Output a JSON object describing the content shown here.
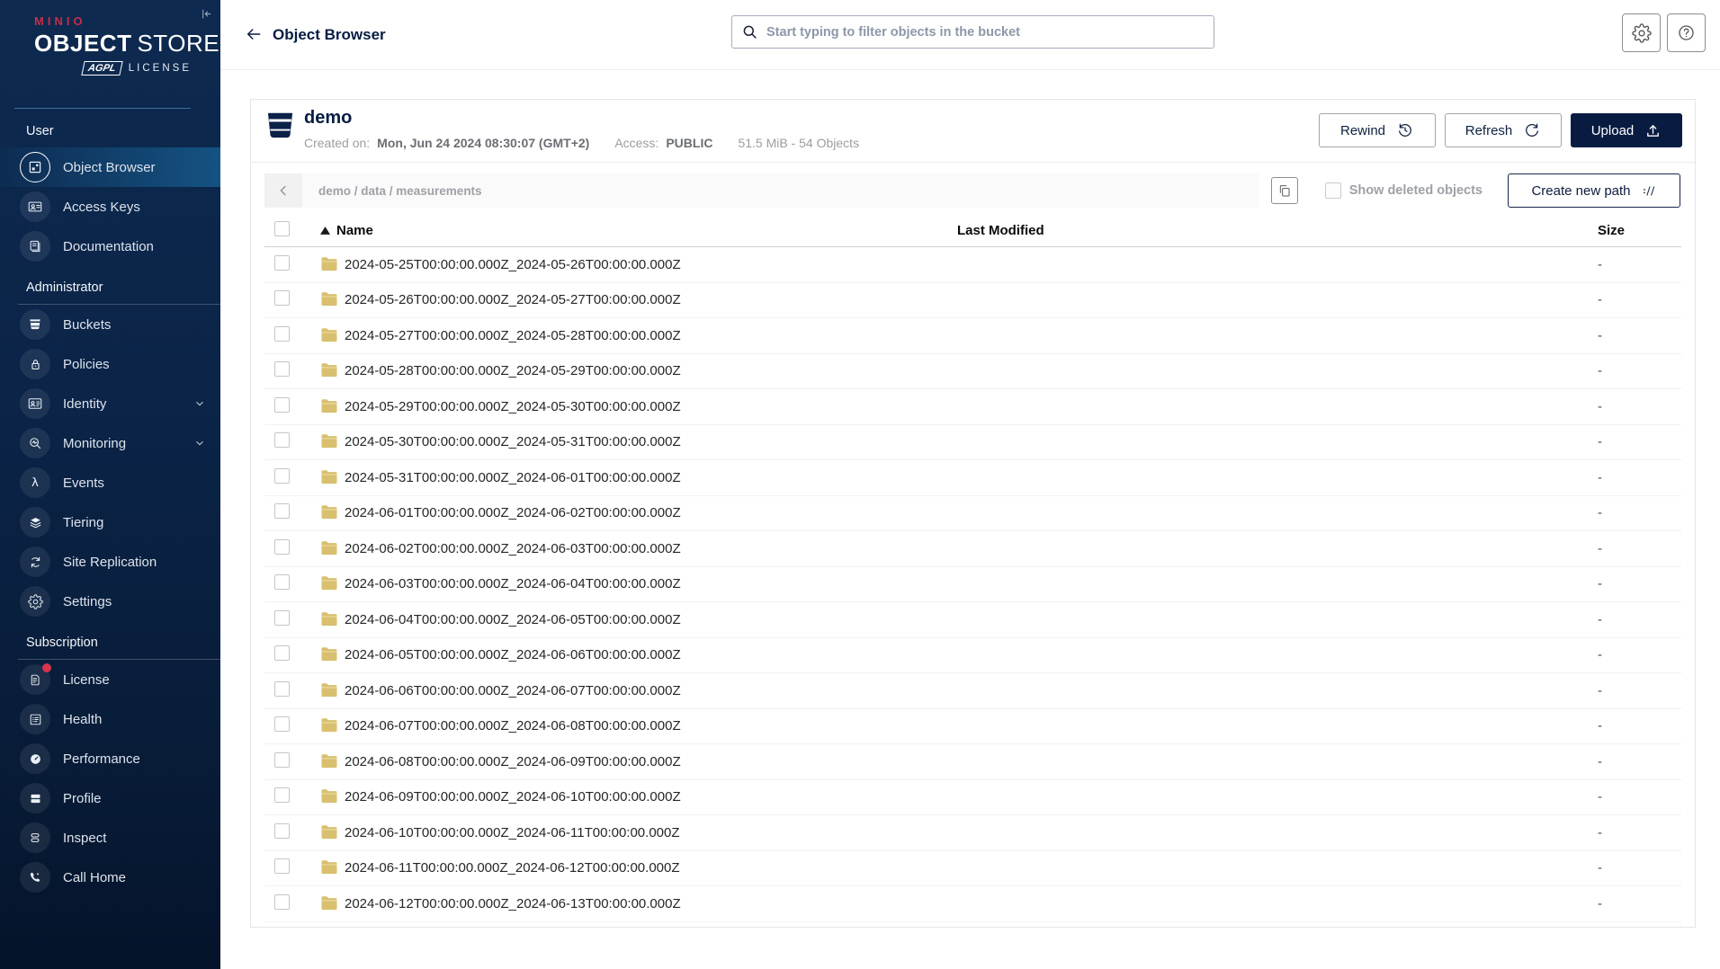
{
  "colors": {
    "brand_red": "#C72C48",
    "primary_navy": "#081C42",
    "sidebar_top": "#0E2A50",
    "sidebar_bottom": "#05132A",
    "selected_item_highlight": "#155585",
    "folder_icon": "#D8C06F",
    "badge_red": "#D8354F"
  },
  "sidebar": {
    "logo": {
      "brand": "MINIO",
      "product_bold": "OBJECT",
      "product_light": "STORE",
      "license_badge": "AGPL",
      "license_label": "LICENSE"
    },
    "sections": [
      {
        "label": "User",
        "items": [
          {
            "icon": "object-browser-icon",
            "label": "Object Browser",
            "selected": true
          },
          {
            "icon": "access-keys-icon",
            "label": "Access Keys"
          },
          {
            "icon": "documentation-icon",
            "label": "Documentation"
          }
        ]
      },
      {
        "label": "Administrator",
        "items": [
          {
            "icon": "buckets-icon",
            "label": "Buckets"
          },
          {
            "icon": "policies-icon",
            "label": "Policies"
          },
          {
            "icon": "identity-icon",
            "label": "Identity",
            "chevron": true
          },
          {
            "icon": "monitoring-icon",
            "label": "Monitoring",
            "chevron": true
          },
          {
            "icon": "events-icon",
            "label": "Events"
          },
          {
            "icon": "tiering-icon",
            "label": "Tiering"
          },
          {
            "icon": "site-replication-icon",
            "label": "Site Replication"
          },
          {
            "icon": "settings-icon",
            "label": "Settings"
          }
        ]
      },
      {
        "label": "Subscription",
        "items": [
          {
            "icon": "license-icon",
            "label": "License",
            "badge": true
          },
          {
            "icon": "health-icon",
            "label": "Health"
          },
          {
            "icon": "performance-icon",
            "label": "Performance"
          },
          {
            "icon": "profile-icon",
            "label": "Profile"
          },
          {
            "icon": "inspect-icon",
            "label": "Inspect"
          },
          {
            "icon": "call-home-icon",
            "label": "Call Home"
          }
        ]
      }
    ]
  },
  "header": {
    "title": "Object Browser",
    "search_placeholder": "Start typing to filter objects in the bucket"
  },
  "bucket": {
    "name": "demo",
    "created_label": "Created on:",
    "created_value": "Mon, Jun 24 2024 08:30:07 (GMT+2)",
    "access_label": "Access:",
    "access_value": "PUBLIC",
    "stats": "51.5 MiB - 54 Objects",
    "actions": {
      "rewind": "Rewind",
      "refresh": "Refresh",
      "upload": "Upload"
    }
  },
  "browser": {
    "breadcrumb": "demo / data / measurements",
    "show_deleted_label": "Show deleted objects",
    "create_path_label": "Create new path"
  },
  "table": {
    "columns": [
      "Name",
      "Last Modified",
      "Size"
    ],
    "sort": {
      "column": "Name",
      "direction": "asc"
    },
    "rows": [
      {
        "icon": "folder-icon",
        "name": "2024-05-25T00:00:00.000Z_2024-05-26T00:00:00.000Z",
        "last_modified": "",
        "size": "-"
      },
      {
        "icon": "folder-icon",
        "name": "2024-05-26T00:00:00.000Z_2024-05-27T00:00:00.000Z",
        "last_modified": "",
        "size": "-"
      },
      {
        "icon": "folder-icon",
        "name": "2024-05-27T00:00:00.000Z_2024-05-28T00:00:00.000Z",
        "last_modified": "",
        "size": "-"
      },
      {
        "icon": "folder-icon",
        "name": "2024-05-28T00:00:00.000Z_2024-05-29T00:00:00.000Z",
        "last_modified": "",
        "size": "-"
      },
      {
        "icon": "folder-icon",
        "name": "2024-05-29T00:00:00.000Z_2024-05-30T00:00:00.000Z",
        "last_modified": "",
        "size": "-"
      },
      {
        "icon": "folder-icon",
        "name": "2024-05-30T00:00:00.000Z_2024-05-31T00:00:00.000Z",
        "last_modified": "",
        "size": "-"
      },
      {
        "icon": "folder-icon",
        "name": "2024-05-31T00:00:00.000Z_2024-06-01T00:00:00.000Z",
        "last_modified": "",
        "size": "-"
      },
      {
        "icon": "folder-icon",
        "name": "2024-06-01T00:00:00.000Z_2024-06-02T00:00:00.000Z",
        "last_modified": "",
        "size": "-"
      },
      {
        "icon": "folder-icon",
        "name": "2024-06-02T00:00:00.000Z_2024-06-03T00:00:00.000Z",
        "last_modified": "",
        "size": "-"
      },
      {
        "icon": "folder-icon",
        "name": "2024-06-03T00:00:00.000Z_2024-06-04T00:00:00.000Z",
        "last_modified": "",
        "size": "-"
      },
      {
        "icon": "folder-icon",
        "name": "2024-06-04T00:00:00.000Z_2024-06-05T00:00:00.000Z",
        "last_modified": "",
        "size": "-"
      },
      {
        "icon": "folder-icon",
        "name": "2024-06-05T00:00:00.000Z_2024-06-06T00:00:00.000Z",
        "last_modified": "",
        "size": "-"
      },
      {
        "icon": "folder-icon",
        "name": "2024-06-06T00:00:00.000Z_2024-06-07T00:00:00.000Z",
        "last_modified": "",
        "size": "-"
      },
      {
        "icon": "folder-icon",
        "name": "2024-06-07T00:00:00.000Z_2024-06-08T00:00:00.000Z",
        "last_modified": "",
        "size": "-"
      },
      {
        "icon": "folder-icon",
        "name": "2024-06-08T00:00:00.000Z_2024-06-09T00:00:00.000Z",
        "last_modified": "",
        "size": "-"
      },
      {
        "icon": "folder-icon",
        "name": "2024-06-09T00:00:00.000Z_2024-06-10T00:00:00.000Z",
        "last_modified": "",
        "size": "-"
      },
      {
        "icon": "folder-icon",
        "name": "2024-06-10T00:00:00.000Z_2024-06-11T00:00:00.000Z",
        "last_modified": "",
        "size": "-"
      },
      {
        "icon": "folder-icon",
        "name": "2024-06-11T00:00:00.000Z_2024-06-12T00:00:00.000Z",
        "last_modified": "",
        "size": "-"
      },
      {
        "icon": "folder-icon",
        "name": "2024-06-12T00:00:00.000Z_2024-06-13T00:00:00.000Z",
        "last_modified": "",
        "size": "-"
      }
    ]
  }
}
